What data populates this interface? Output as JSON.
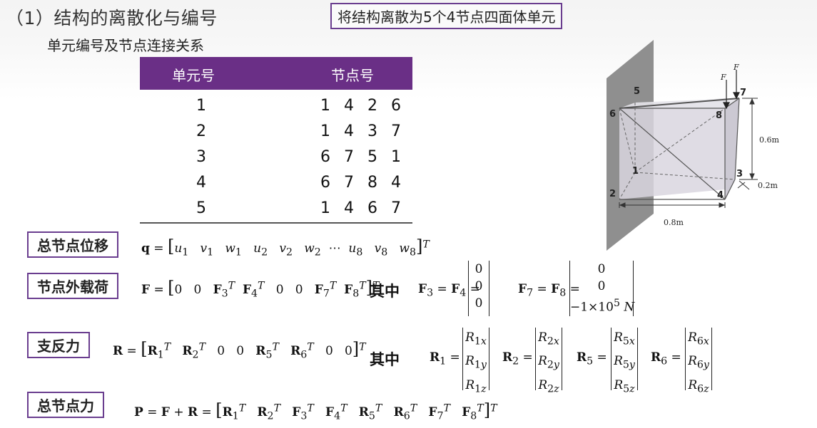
{
  "title": "（1）结构的离散化与编号",
  "callout": "将结构离散为5个4节点四面体单元",
  "subtitle": "单元编号及节点连接关系",
  "table": {
    "headers": [
      "单元号",
      "节点号"
    ],
    "rows": [
      {
        "unit": "1",
        "nodes": "1 4 2 6"
      },
      {
        "unit": "2",
        "nodes": "1 4 3 7"
      },
      {
        "unit": "3",
        "nodes": "6 7 5 1"
      },
      {
        "unit": "4",
        "nodes": "6 7 8 4"
      },
      {
        "unit": "5",
        "nodes": "1 4 6 7"
      }
    ]
  },
  "labels": {
    "disp": "总节点位移",
    "load": "节点外载荷",
    "react": "支反力",
    "total": "总节点力"
  },
  "qizhong": "其中",
  "figure": {
    "nodes": [
      "1",
      "2",
      "3",
      "4",
      "5",
      "6",
      "7",
      "8"
    ],
    "force_label": "F",
    "dim_height": "0.6m",
    "dim_depth": "0.2m",
    "dim_width": "0.8m"
  },
  "colors": {
    "accent": "#6a2f86",
    "border": "#6a3d8f"
  }
}
